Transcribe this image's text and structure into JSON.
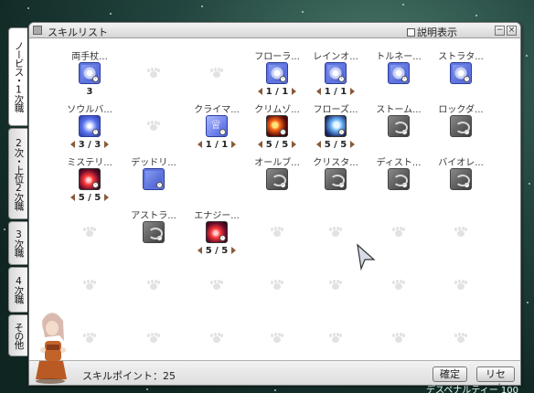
{
  "window": {
    "title": "スキルリスト",
    "desc_toggle_label": "説明表示",
    "minimize_symbol": "−",
    "close_symbol": "×"
  },
  "side_tabs": [
    {
      "label": "ノービス・1次職",
      "active": true
    },
    {
      "label": "2次・上位2次職",
      "active": false
    },
    {
      "label": "3次職",
      "active": false
    },
    {
      "label": "4次職",
      "active": false
    },
    {
      "label": "その他",
      "active": false
    }
  ],
  "skills": [
    {
      "name": "両手杖...",
      "icon": "blue-tile-icon",
      "level": "3",
      "arrows": false
    },
    {
      "name": "フローラ...",
      "icon": "blue-tile-icon",
      "level": "1 / 1",
      "arrows": true
    },
    {
      "name": "レインオ...",
      "icon": "blue-tile-icon",
      "level": "1 / 1",
      "arrows": true
    },
    {
      "name": "トルネー...",
      "icon": "blue-tile-icon",
      "level": "",
      "arrows": false
    },
    {
      "name": "ストラタ...",
      "icon": "blue-tile-icon",
      "level": "",
      "arrows": false
    },
    {
      "name": "ソウルバ...",
      "icon": "burst-icon",
      "level": "3 / 3",
      "arrows": true
    },
    {
      "name": "クライマ...",
      "icon": "crown-icon",
      "level": "1 / 1",
      "arrows": true
    },
    {
      "name": "クリムゾ...",
      "icon": "fire-icon",
      "level": "5 / 5",
      "arrows": true
    },
    {
      "name": "フローズ...",
      "icon": "ice-icon",
      "level": "5 / 5",
      "arrows": true
    },
    {
      "name": "ストーム...",
      "icon": "gray-skill-icon",
      "level": "",
      "arrows": false
    },
    {
      "name": "ロックダ...",
      "icon": "gray-skill-icon",
      "level": "",
      "arrows": false
    },
    {
      "name": "ミステリ...",
      "icon": "red-skill-icon",
      "level": "5 / 5",
      "arrows": true
    },
    {
      "name": "デッドリ...",
      "icon": "blue-tile-icon",
      "level": "",
      "arrows": false
    },
    {
      "name": "オールブ...",
      "icon": "gray-skill-icon",
      "level": "",
      "arrows": false
    },
    {
      "name": "クリスタ...",
      "icon": "gray-skill-icon",
      "level": "",
      "arrows": false
    },
    {
      "name": "ディスト...",
      "icon": "gray-skill-icon",
      "level": "",
      "arrows": false
    },
    {
      "name": "バイオレ...",
      "icon": "gray-skill-icon",
      "level": "",
      "arrows": false
    },
    {
      "name": "アストラ...",
      "icon": "gray-skill-icon",
      "level": "",
      "arrows": false
    },
    {
      "name": "エナジー...",
      "icon": "red-skill-icon",
      "level": "5 / 5",
      "arrows": true
    }
  ],
  "footer": {
    "skill_points_label": "スキルポイント：25",
    "confirm_label": "確定",
    "reset_label": "リセット"
  },
  "background_text": "デスペナルティー 100"
}
